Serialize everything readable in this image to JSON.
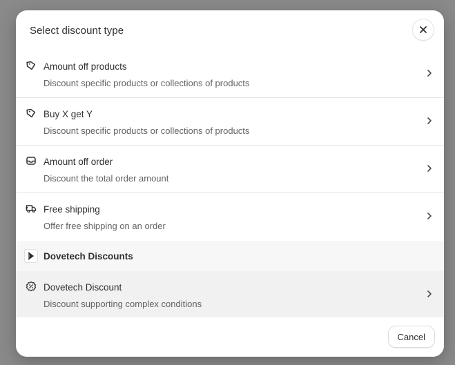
{
  "modal": {
    "title": "Select discount type",
    "close_icon": "close-icon"
  },
  "options": [
    {
      "title": "Amount off products",
      "description": "Discount specific products or collections of products",
      "icon": "tag-icon"
    },
    {
      "title": "Buy X get Y",
      "description": "Discount specific products or collections of products",
      "icon": "tag-icon"
    },
    {
      "title": "Amount off order",
      "description": "Discount the total order amount",
      "icon": "inbox-icon"
    },
    {
      "title": "Free shipping",
      "description": "Offer free shipping on an order",
      "icon": "truck-icon"
    }
  ],
  "app_section": {
    "title": "Dovetech Discounts",
    "logo_icon": "dovetech-logo-icon",
    "options": [
      {
        "title": "Dovetech Discount",
        "description": "Discount supporting complex conditions",
        "icon": "discount-badge-icon"
      }
    ]
  },
  "footer": {
    "cancel_label": "Cancel"
  },
  "colors": {
    "backdrop": "#8a8a8a",
    "text_primary": "#303030",
    "text_secondary": "#616161",
    "highlight_row": "#f1f1f1"
  }
}
